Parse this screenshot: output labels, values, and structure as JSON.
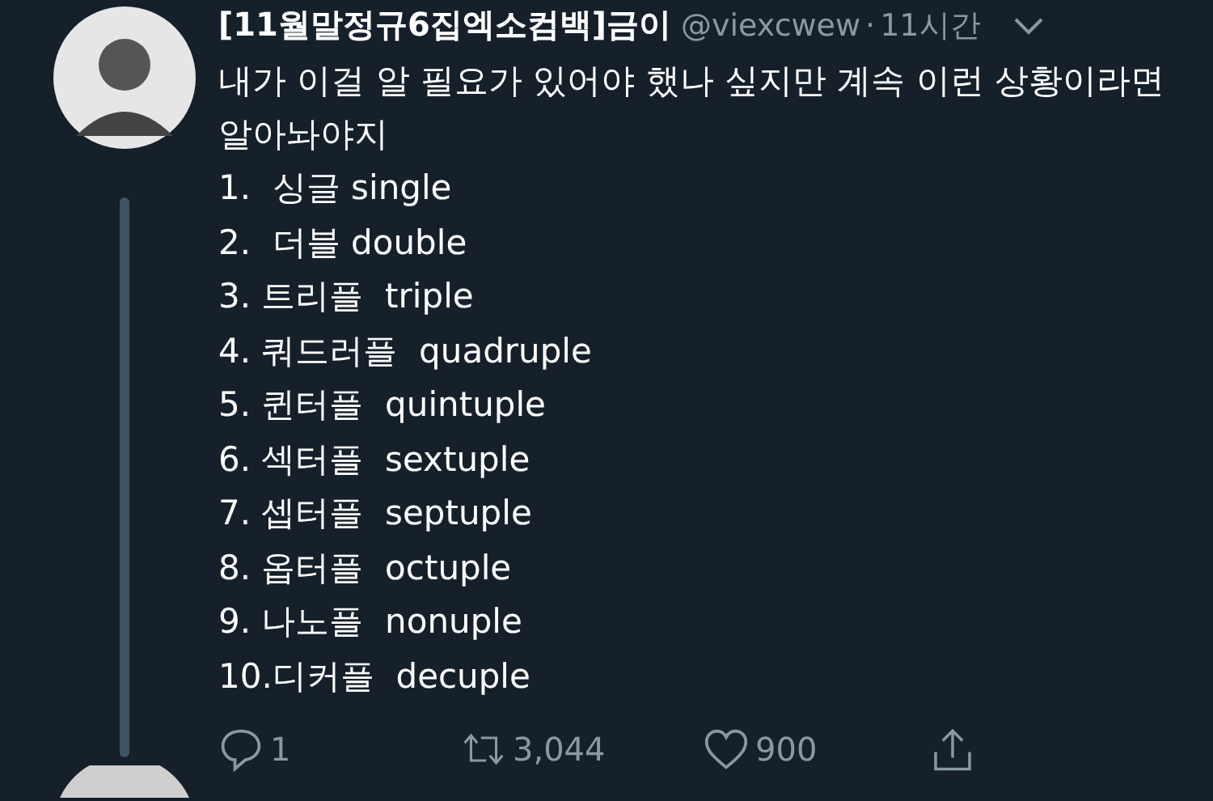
{
  "tweet": {
    "name": "[11월말정규6집엑소컴백]금이",
    "handle": "@viexcwew",
    "separator": "·",
    "time": "11시간",
    "text": "내가 이걸 알 필요가 있어야 했나 싶지만 계속 이런 상황이라면 알아놔야지",
    "list": [
      "1.  싱글 single",
      "2.  더블 double",
      "3. 트리플  triple",
      "4. 쿼드러플  quadruple",
      "5. 퀸터플  quintuple",
      "6. 섹터플  sextuple",
      "7. 셉터플  septuple",
      "8. 옵터플  octuple",
      "9. 나노플  nonuple",
      "10.디커플  decuple"
    ],
    "replies": "1",
    "retweets": "3,044",
    "likes": "900"
  }
}
